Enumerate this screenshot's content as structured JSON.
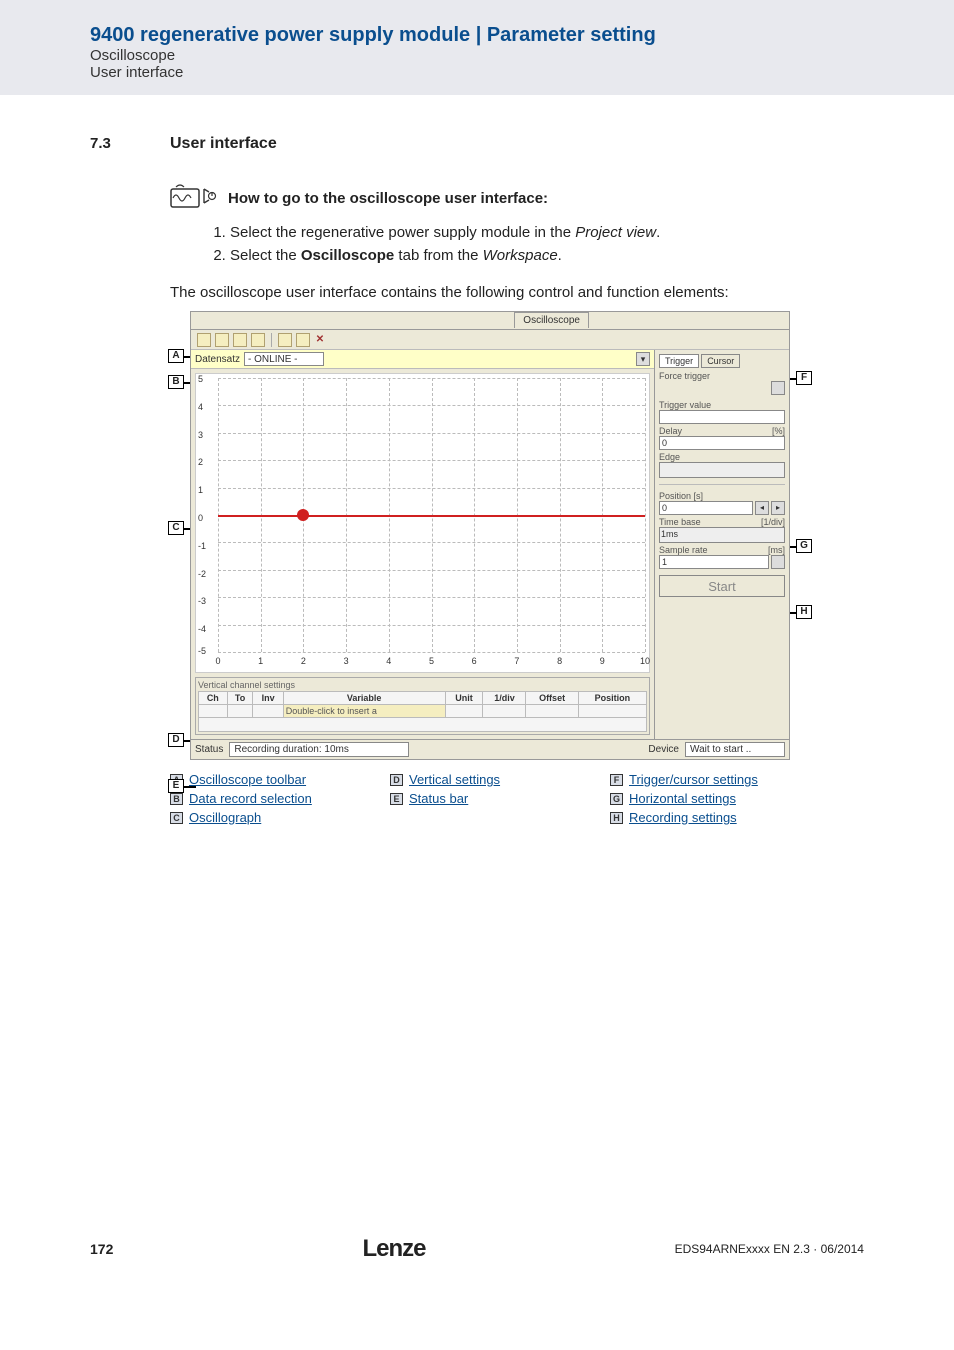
{
  "header": {
    "title": "9400 regenerative power supply module | Parameter setting",
    "sub1": "Oscilloscope",
    "sub2": "User interface"
  },
  "section": {
    "num": "7.3",
    "title": "User interface"
  },
  "howto": {
    "title": "How to go to the oscilloscope user interface:",
    "step1_pre": "Select the regenerative power supply module in the ",
    "step1_it": "Project view",
    "step1_post": ".",
    "step2_pre": "Select the ",
    "step2_bold": "Oscilloscope",
    "step2_mid": " tab from the ",
    "step2_it": "Workspace",
    "step2_post": "."
  },
  "intro": "The oscilloscope user interface contains the following control and function elements:",
  "scr": {
    "tab": "Oscilloscope",
    "datarow": {
      "label": "Datensatz",
      "value": "- ONLINE -"
    },
    "plot": {
      "y": [
        "5",
        "4",
        "3",
        "2",
        "1",
        "0",
        "-1",
        "-2",
        "-3",
        "-4",
        "-5"
      ],
      "x": [
        "0",
        "1",
        "2",
        "3",
        "4",
        "5",
        "6",
        "7",
        "8",
        "9",
        "10"
      ]
    },
    "vset": {
      "group": "Vertical channel settings",
      "cols": [
        "Ch",
        "To",
        "Inv",
        "Variable",
        "Unit",
        "1/div",
        "Offset",
        "Position"
      ],
      "hint": "Double-click to insert a"
    },
    "status": {
      "label": "Status",
      "rec": "Recording duration: 10ms",
      "devlabel": "Device",
      "dev": "Wait to start .."
    },
    "rp": {
      "tab_trigger": "Trigger",
      "tab_cursor": "Cursor",
      "force": "Force trigger",
      "trigval": "Trigger value",
      "delay": "Delay",
      "delay_u": "[%]",
      "delay_val": "0",
      "edge": "Edge",
      "pos": "Position [s]",
      "pos_val": "0",
      "tb": "Time base",
      "tb_u": "[1/div]",
      "tb_val": "1ms",
      "sr": "Sample rate",
      "sr_u": "[ms]",
      "sr_val": "1",
      "start": "Start"
    }
  },
  "markers": {
    "A": "A",
    "B": "B",
    "C": "C",
    "D": "D",
    "E": "E",
    "F": "F",
    "G": "G",
    "H": "H"
  },
  "legend": {
    "A": "Oscilloscope toolbar",
    "B": "Data record selection",
    "C": "Oscillograph",
    "D": "Vertical settings",
    "E": "Status bar",
    "F": "Trigger/cursor settings",
    "G": "Horizontal settings",
    "H": "Recording settings"
  },
  "footer": {
    "page": "172",
    "logo": "Lenze",
    "docid": "EDS94ARNExxxx EN 2.3 · 06/2014"
  }
}
